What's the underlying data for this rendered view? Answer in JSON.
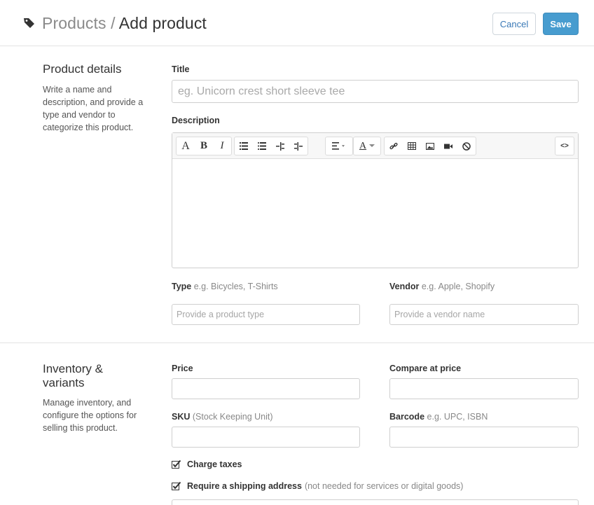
{
  "header": {
    "breadcrumb_parent": "Products",
    "breadcrumb_sep": " / ",
    "breadcrumb_current": "Add product",
    "cancel_label": "Cancel",
    "save_label": "Save"
  },
  "product_details": {
    "title": "Product details",
    "description": "Write a name and description, and provide a type and vendor to categorize this product.",
    "title_label": "Title",
    "title_placeholder": "eg. Unicorn crest short sleeve tee",
    "description_label": "Description",
    "type_label": "Type",
    "type_hint": "e.g. Bicycles, T-Shirts",
    "type_placeholder": "Provide a product type",
    "vendor_label": "Vendor",
    "vendor_hint": "e.g. Apple, Shopify",
    "vendor_placeholder": "Provide a vendor name"
  },
  "editor_toolbar": {
    "font_label": "A",
    "bold_label": "B",
    "italic_label": "I",
    "color_label": "A",
    "html_label": "<>",
    "icons": [
      "font-icon",
      "bold-icon",
      "italic-icon",
      "unordered-list-icon",
      "ordered-list-icon",
      "outdent-icon",
      "indent-icon",
      "align-icon",
      "text-color-icon",
      "link-icon",
      "table-icon",
      "image-icon",
      "video-icon",
      "clear-format-icon",
      "html-source-icon"
    ]
  },
  "inventory": {
    "title": "Inventory & variants",
    "description": "Manage inventory, and configure the options for selling this product.",
    "price_label": "Price",
    "compare_label": "Compare at price",
    "sku_label": "SKU",
    "sku_hint": "(Stock Keeping Unit)",
    "barcode_label": "Barcode",
    "barcode_hint": "e.g. UPC, ISBN",
    "charge_taxes_label": "Charge taxes",
    "charge_taxes_checked": true,
    "shipping_label": "Require a shipping address",
    "shipping_hint": "(not needed for services or digital goods)",
    "shipping_checked": true
  },
  "colors": {
    "primary": "#479ccf",
    "link": "#3a79b6",
    "border": "#cfcfcf",
    "muted_text": "#888888"
  }
}
